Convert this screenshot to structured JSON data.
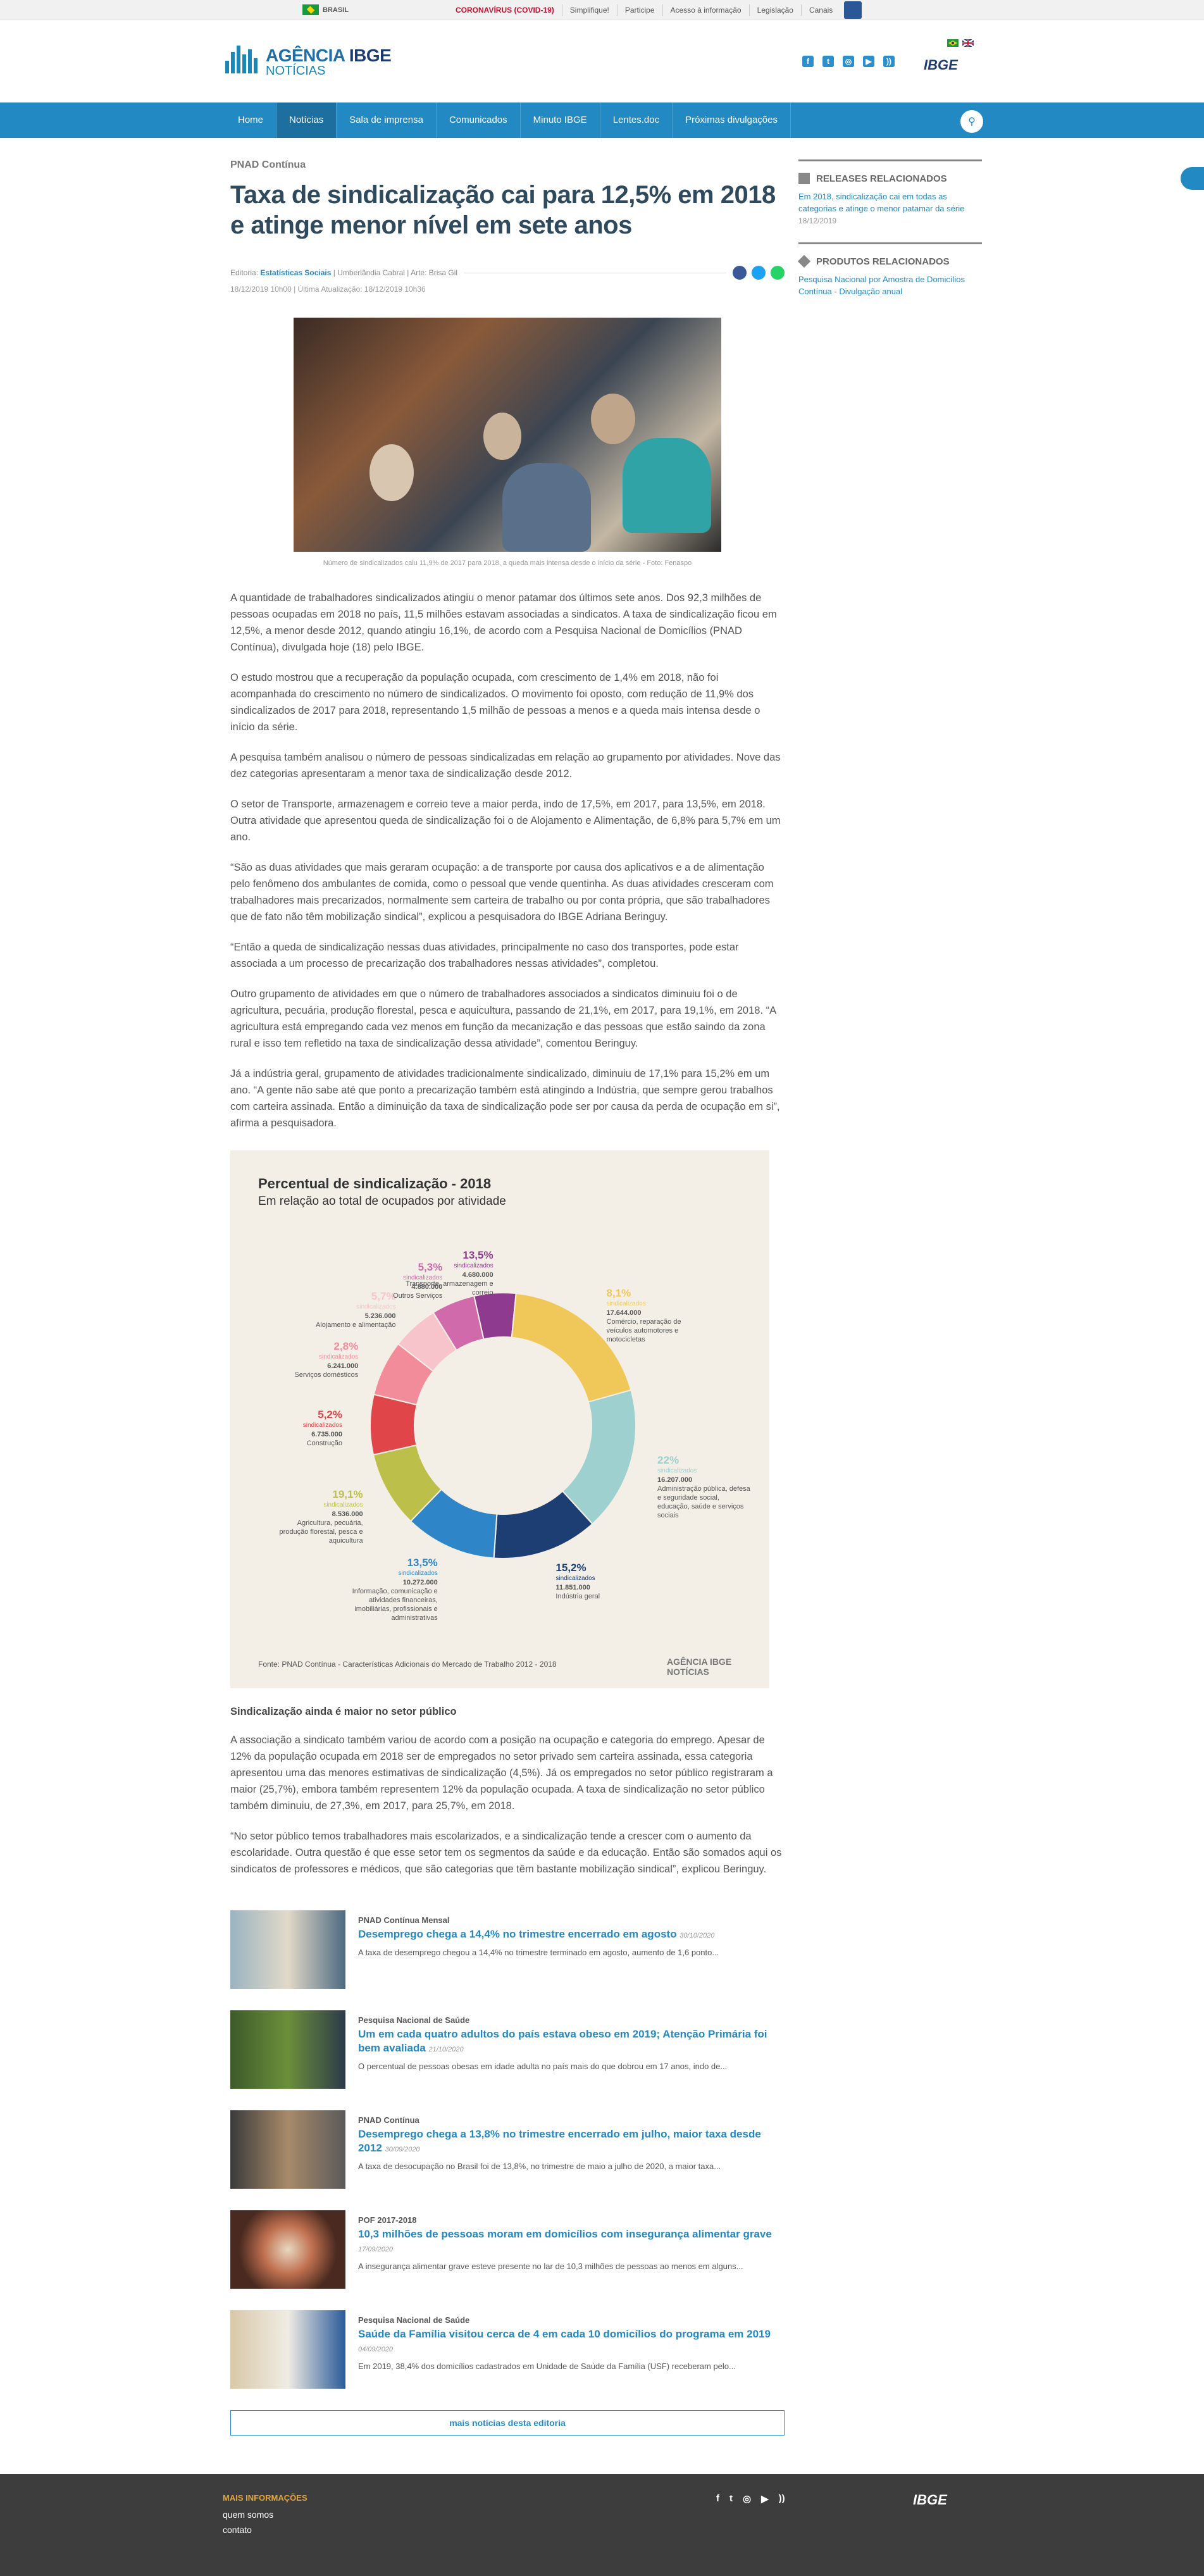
{
  "govbar": {
    "country": "BRASIL",
    "links": [
      "CORONAVÍRUS (COVID-19)",
      "Simplifique!",
      "Participe",
      "Acesso à informação",
      "Legislação",
      "Canais"
    ]
  },
  "header": {
    "logo_main": "AGÊNCIA",
    "logo_bold": "IBGE",
    "logo_sub": "NOTÍCIAS",
    "ibge": "IBGE",
    "social_icons": [
      "facebook-icon",
      "twitter-icon",
      "instagram-icon",
      "youtube-icon",
      "rss-icon"
    ]
  },
  "nav": {
    "items": [
      "Home",
      "Notícias",
      "Sala de imprensa",
      "Comunicados",
      "Minuto IBGE",
      "Lentes.doc",
      "Próximas divulgações"
    ],
    "active": "Notícias"
  },
  "article": {
    "kicker": "PNAD Contínua",
    "title": "Taxa de sindicalização cai para 12,5% em 2018 e atinge menor nível em sete anos",
    "meta_editoria_label": "Editoria:",
    "meta_editoria": "Estatísticas Sociais",
    "meta_author": "| Umberlândia Cabral | Arte: Brisa Gil",
    "dates": "18/12/2019 10h00 | Última Atualização: 18/12/2019 10h36",
    "photo_caption": "Número de sindicalizados caiu 11,9% de 2017 para 2018, a queda mais intensa desde o início da série - Foto: Fenaspo",
    "paragraphs": [
      "A quantidade de trabalhadores sindicalizados atingiu o menor patamar dos últimos sete anos. Dos 92,3 milhões de pessoas ocupadas em 2018 no país, 11,5 milhões estavam associadas a sindicatos. A taxa de sindicalização ficou em 12,5%, a menor desde 2012, quando atingiu 16,1%, de acordo com a Pesquisa Nacional de Domicílios (PNAD Contínua), divulgada hoje (18) pelo IBGE.",
      "O estudo mostrou que a recuperação da população ocupada, com crescimento de 1,4% em 2018, não foi acompanhada do crescimento no número de sindicalizados. O movimento foi oposto, com redução de 11,9% dos sindicalizados de 2017 para 2018, representando 1,5 milhão de pessoas a menos e a queda mais intensa desde o início da série.",
      "A pesquisa também analisou o número de pessoas sindicalizadas em relação ao grupamento por atividades. Nove das dez categorias apresentaram a menor taxa de sindicalização desde 2012.",
      "O setor de Transporte, armazenagem e correio teve a maior perda, indo de 17,5%, em 2017, para 13,5%, em 2018. Outra atividade que apresentou queda de sindicalização foi o de Alojamento e Alimentação, de 6,8% para 5,7% em um ano.",
      "“São as duas atividades que mais geraram ocupação: a de transporte por causa dos aplicativos e a de alimentação pelo fenômeno dos ambulantes de comida, como o pessoal que vende quentinha. As duas atividades cresceram com trabalhadores mais precarizados, normalmente sem carteira de trabalho ou por conta própria, que são trabalhadores que de fato não têm mobilização sindical”, explicou a pesquisadora do IBGE Adriana Beringuy.",
      "“Então a queda de sindicalização nessas duas atividades, principalmente no caso dos transportes, pode estar associada a um processo de precarização dos trabalhadores nessas atividades”, completou.",
      "Outro grupamento de atividades em que o número de trabalhadores associados a sindicatos diminuiu foi o de agricultura, pecuária, produção florestal, pesca e aquicultura, passando de 21,1%, em 2017, para 19,1%, em 2018. “A agricultura está empregando cada vez menos em função da mecanização e das pessoas que estão saindo da zona rural e isso tem refletido na taxa de sindicalização dessa atividade”, comentou Beringuy.",
      "Já a indústria geral, grupamento de atividades tradicionalmente sindicalizado, diminuiu de 17,1% para 15,2% em um ano. “A gente não sabe até que ponto a precarização também está atingindo a Indústria, que sempre gerou trabalhos com carteira assinada. Então a diminuição da taxa de sindicalização pode ser por causa da perda de ocupação em si”, afirma a pesquisadora."
    ],
    "subheading": "Sindicalização ainda é maior no setor público",
    "paragraphs2": [
      "A associação a sindicato também variou de acordo com a posição na ocupação e categoria do emprego. Apesar de 12% da população ocupada em 2018 ser de empregados no setor privado sem carteira assinada, essa categoria apresentou uma das menores estimativas de sindicalização (4,5%). Já os empregados no setor público registraram a maior (25,7%), embora também representem 12% da população ocupada. A taxa de sindicalização no setor público também diminuiu, de 27,3%, em 2017, para 25,7%, em 2018.",
      "“No setor público temos trabalhadores mais escolarizados, e a sindicalização tende a crescer com o aumento da escolaridade. Outra questão é que esse setor tem os segmentos da saúde e da educação. Então são somados aqui os sindicatos de professores e médicos, que são categorias que têm bastante mobilização sindical”, explicou Beringuy."
    ]
  },
  "infographic": {
    "title": "Percentual de sindicalização - 2018",
    "subtitle": "Em relação ao total de ocupados por atividade",
    "source": "Fonte: PNAD Contínua - Características Adicionais do Mercado de Trabalho 2012 - 2018",
    "logo": "AGÊNCIA IBGE NOTÍCIAS",
    "rate_label": "sindicalizados"
  },
  "chart_data": {
    "type": "pie",
    "title": "Percentual de sindicalização - 2018",
    "subtitle": "Em relação ao total de ocupados por atividade",
    "series": [
      {
        "name": "Transporte, armazenagem e correio",
        "rate": "13,5%",
        "ocupados": "4.680.000",
        "value": 4680000,
        "color": "#8e3a8e"
      },
      {
        "name": "Comércio, reparação de veículos automotores e motocicletas",
        "rate": "8,1%",
        "ocupados": "17.644.000",
        "value": 17644000,
        "color": "#f0c85a"
      },
      {
        "name": "Administração pública, defesa e seguridade social, educação, saúde e serviços sociais",
        "rate": "22%",
        "ocupados": "16.207.000",
        "value": 16207000,
        "color": "#9dd0cf"
      },
      {
        "name": "Indústria geral",
        "rate": "15,2%",
        "ocupados": "11.851.000",
        "value": 11851000,
        "color": "#1c3e72"
      },
      {
        "name": "Informação, comunicação e atividades financeiras, imobiliárias, profissionais e administrativas",
        "rate": "13,5%",
        "ocupados": "10.272.000",
        "value": 10272000,
        "color": "#2e86c8"
      },
      {
        "name": "Agricultura, pecuária, produção florestal, pesca e aquicultura",
        "rate": "19,1%",
        "ocupados": "8.536.000",
        "value": 8536000,
        "color": "#bcc04a"
      },
      {
        "name": "Construção",
        "rate": "5,2%",
        "ocupados": "6.735.000",
        "value": 6735000,
        "color": "#e0454a"
      },
      {
        "name": "Serviços domésticos",
        "rate": "2,8%",
        "ocupados": "6.241.000",
        "value": 6241000,
        "color": "#f28b9a"
      },
      {
        "name": "Alojamento e alimentação",
        "rate": "5,7%",
        "ocupados": "5.236.000",
        "value": 5236000,
        "color": "#f8c4cc"
      },
      {
        "name": "Outros Serviços",
        "rate": "5,3%",
        "ocupados": "4.880.000",
        "value": 4880000,
        "color": "#d06aab"
      }
    ],
    "legend": "callouts-around"
  },
  "related": [
    {
      "kicker": "PNAD Contínua Mensal",
      "title": "Desemprego chega a 14,4% no trimestre encerrado em agosto",
      "date": "30/10/2020",
      "summary": "A taxa de desemprego chegou a 14,4% no trimestre terminado em agosto, aumento de 1,6 ponto..."
    },
    {
      "kicker": "Pesquisa Nacional de Saúde",
      "title": "Um em cada quatro adultos do país estava obeso em 2019; Atenção Primária foi bem avaliada",
      "date": "21/10/2020",
      "summary": "O percentual de pessoas obesas em idade adulta no país mais do que dobrou em 17 anos, indo de..."
    },
    {
      "kicker": "PNAD Contínua",
      "title": "Desemprego chega a 13,8% no trimestre encerrado em julho, maior taxa desde 2012",
      "date": "30/09/2020",
      "summary": "A taxa de desocupação no Brasil foi de 13,8%, no trimestre de maio a julho de 2020, a maior taxa..."
    },
    {
      "kicker": "POF 2017-2018",
      "title": "10,3 milhões de pessoas moram em domicílios com insegurança alimentar grave",
      "date": "17/09/2020",
      "summary": "A insegurança alimentar grave esteve presente no lar de 10,3 milhões de pessoas ao menos em alguns..."
    },
    {
      "kicker": "Pesquisa Nacional de Saúde",
      "title": "Saúde da Família visitou cerca de 4 em cada 10 domicílios do programa em 2019",
      "date": "04/09/2020",
      "summary": "Em 2019, 38,4% dos domicílios cadastrados em Unidade de Saúde da Família (USF) receberam pelo..."
    }
  ],
  "more_link": "mais notícias desta editoria",
  "sidebar": {
    "releases_title": "RELEASES RELACIONADOS",
    "releases_link": "Em 2018, sindicalização cai em todas as categorias e atinge o menor patamar da série",
    "releases_date": "18/12/2019",
    "products_title": "PRODUTOS RELACIONADOS",
    "products_link": "Pesquisa Nacional por Amostra de Domicílios Contínua - Divulgação anual"
  },
  "footer": {
    "heading": "MAIS INFORMAÇÕES",
    "links": [
      "quem somos",
      "contato"
    ],
    "logo": "IBGE"
  },
  "colors": {
    "primary": "#2389c2",
    "nav_active": "#1d6fa0",
    "footer": "#3d3d3d",
    "accent": "#e7a437"
  }
}
